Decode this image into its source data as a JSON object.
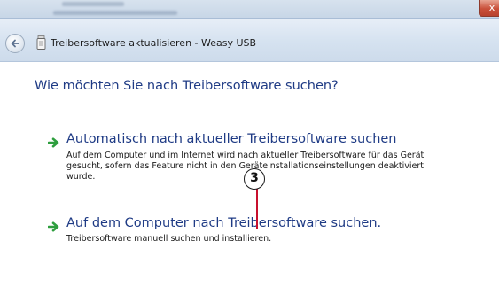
{
  "window": {
    "title": "Treibersoftware aktualisieren - Weasy USB",
    "close_label": "x"
  },
  "heading": "Wie möchten Sie nach Treibersoftware suchen?",
  "options": [
    {
      "title": "Automatisch nach aktueller Treibersoftware suchen",
      "description": "Auf dem Computer und im Internet wird nach aktueller Treibersoftware für das Gerät gesucht, sofern das Feature nicht in den Geräteinstallationseinstellungen deaktiviert wurde."
    },
    {
      "title": "Auf dem Computer nach Treibersoftware suchen.",
      "description": "Treibersoftware manuell suchen und installieren."
    }
  ],
  "callout": {
    "number": "3"
  },
  "colors": {
    "heading_blue": "#1f3b85",
    "arrow_green": "#2e9e3e",
    "callout_red": "#c8102e",
    "chrome_blue": "#d5e2f0"
  },
  "icons": {
    "back": "back-arrow-icon",
    "device": "usb-device-icon",
    "option": "green-arrow-icon"
  }
}
